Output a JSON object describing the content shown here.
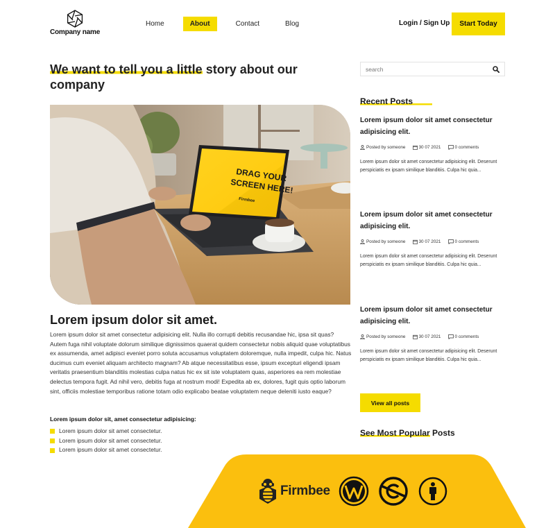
{
  "header": {
    "company_name": "Company name",
    "nav": [
      {
        "label": "Home",
        "active": false
      },
      {
        "label": "About",
        "active": true
      },
      {
        "label": "Contact",
        "active": false
      },
      {
        "label": "Blog",
        "active": false
      }
    ],
    "login_label": "Login / Sign Up",
    "cta_label": "Start Today"
  },
  "main": {
    "title_highlight": "We want to tell you a little",
    "title_rest": " story about our company",
    "hero_screen_text_1": "DRAG YOUR",
    "hero_screen_text_2": "SCREEN HERE!",
    "hero_screen_brand": "Firmbee",
    "section_title": "Lorem ipsum dolor sit amet.",
    "body": "Lorem ipsum dolor sit amet consectetur adipisicing elit. Nulla illo corrupti debitis recusandae hic, ipsa sit quas? Autem fuga nihil voluptate dolorum similique dignissimos quaerat quidem consectetur nobis aliquid quae voluptatibus ex assumenda, amet adipisci eveniet porro soluta accusamus voluptatem doloremque, nulla impedit, culpa hic. Natus ducimus cum eveniet aliquam architecto magnam? Ab atque necessitatibus esse, ipsum excepturi eligendi ipsam veritatis praesentium blanditiis molestias culpa natus hic ex sit iste voluptatem quas, asperiores ea rem molestiae delectus tempora fugit. Ad nihil vero, debitis fuga at nostrum modi! Expedita ab ex, dolores, fugit quis optio laborum sint, officiis molestiae temporibus ratione totam odio explicabo beatae voluptatem neque deleniti iusto eaque?",
    "list_title": "Lorem ipsum dolor sit, amet consectetur adipisicing:",
    "list_items": [
      "Lorem ipsum dolor sit amet consectetur.",
      "Lorem ipsum dolor sit amet consectetur.",
      "Lorem ipsum dolor sit amet consectetur."
    ]
  },
  "sidebar": {
    "search_placeholder": "search",
    "recent_title": "Recent Posts",
    "posts": [
      {
        "title": "Lorem ipsum dolor sit amet consectetur adipisicing elit.",
        "author": "Posted by someone",
        "date": "30 07 2021",
        "comments": "0 comments",
        "excerpt": "Lorem ipsum dolor sit amet consectetur adipisicing elit. Deserunt perspiciatis ex ipsam similique blanditiis. Culpa hic quia..."
      },
      {
        "title": "Lorem ipsum dolor sit amet consectetur adipisicing elit.",
        "author": "Posted by someone",
        "date": "30 07 2021",
        "comments": "0 comments",
        "excerpt": "Lorem ipsum dolor sit amet consectetur adipisicing elit. Deserunt perspiciatis ex ipsam similique blanditiis. Culpa hic quia..."
      },
      {
        "title": "Lorem ipsum dolor sit amet consectetur adipisicing elit.",
        "author": "Posted by someone",
        "date": "30 07 2021",
        "comments": "0 comments",
        "excerpt": "Lorem ipsum dolor sit amet consectetur adipisicing elit. Deserunt perspiciatis ex ipsam similique blanditiis. Culpa hic quia..."
      }
    ],
    "view_all_label": "View all posts",
    "popular_highlight": "See Most Popular",
    "popular_rest": " Posts"
  },
  "footer_badge": {
    "brand": "Firmbee",
    "icons": [
      "wordpress-icon",
      "no-copyright-icon",
      "attribution-person-icon"
    ]
  },
  "colors": {
    "accent": "#f5dc00",
    "badge": "#fbbf0e",
    "text": "#232323"
  }
}
